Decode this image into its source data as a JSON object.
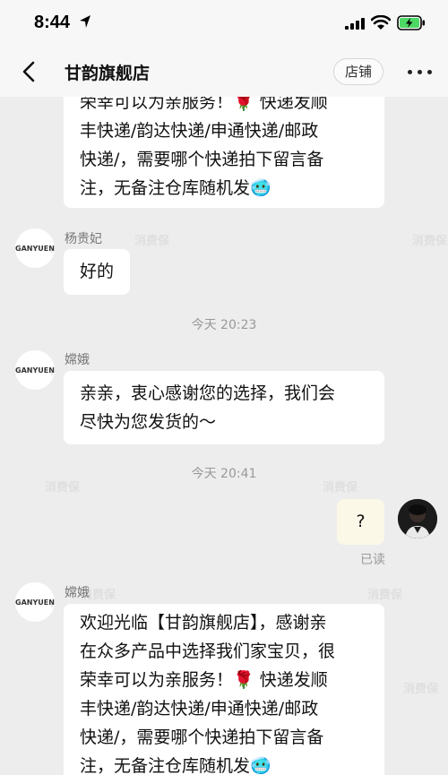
{
  "status_bar": {
    "time": "8:44",
    "icons": [
      "location-arrow-icon",
      "signal-icon",
      "wifi-icon",
      "battery-charging-icon"
    ]
  },
  "nav": {
    "title": "甘韵旗舰店",
    "shop_button": "店铺",
    "icons": [
      "chevron-left-icon",
      "more-horizontal-icon"
    ]
  },
  "messages": [
    {
      "type": "shop",
      "lines": [
        "荣幸可以为亲服务！🌹 快递发顺",
        "丰快递/韵达快递/申通快递/邮政",
        "快递/，需要哪个快递拍下留言备",
        "注，无备注仓库随机发🥶"
      ]
    },
    {
      "type": "shop",
      "sender": "杨贵妃",
      "lines": [
        "好的"
      ]
    },
    {
      "type": "time",
      "text": "今天 20:23"
    },
    {
      "type": "shop",
      "sender": "嫦娥",
      "lines": [
        "亲亲，衷心感谢您的选择，我们会",
        "尽快为您发货的～"
      ]
    },
    {
      "type": "time",
      "text": "今天 20:41"
    },
    {
      "type": "mine",
      "lines": [
        "?"
      ],
      "status": "已读"
    },
    {
      "type": "shop",
      "sender": "嫦娥",
      "lines": [
        "欢迎光临【甘韵旗舰店】，感谢亲",
        "在众多产品中选择我们家宝贝，很",
        "荣幸可以为亲服务！🌹 快递发顺",
        "丰快递/韵达快递/申通快递/邮政",
        "快递/，需要哪个快递拍下留言备",
        "注，无备注仓库随机发🥶"
      ]
    }
  ],
  "avatar_logo_text": "GANYUEN",
  "watermark_text": "消费保"
}
